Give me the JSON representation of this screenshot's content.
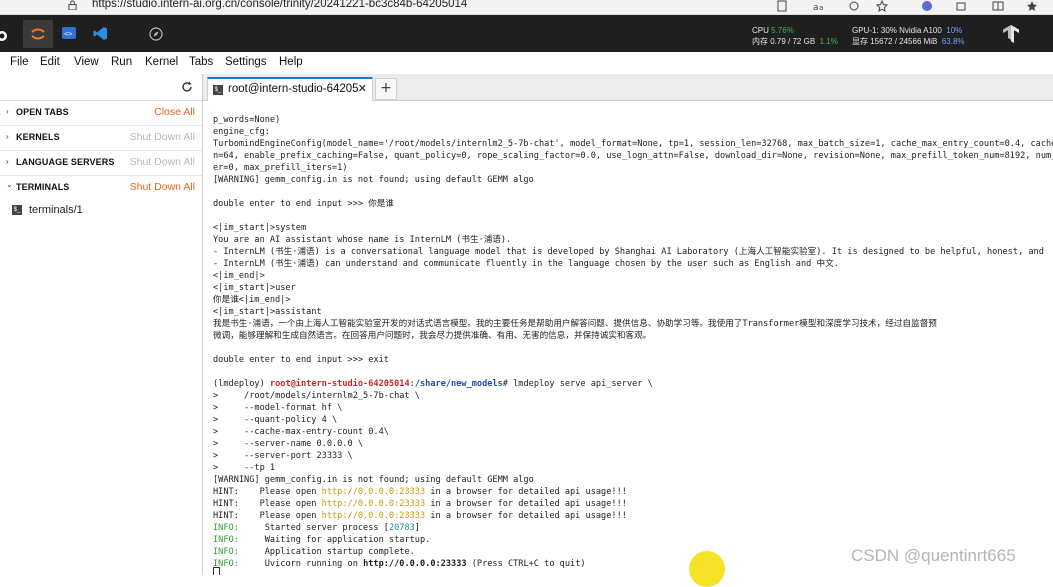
{
  "browser": {
    "url": "https://studio.intern-ai.org.cn/console/trinity/20241221-bc3c84b-64205014"
  },
  "stats": {
    "cpu_label": "CPU",
    "cpu_value": "5.76%",
    "mem_label": "内存",
    "mem_value": "0.79 / 72 GB",
    "mem_pct": "1.1%",
    "gpu_label": "GPU-1: 30% Nvidia A100",
    "gpu_pct": "10%",
    "vram_label": "显存",
    "vram_value": "15672 / 24566 MiB",
    "vram_pct": "63.8%"
  },
  "menu": [
    "File",
    "Edit",
    "View",
    "Run",
    "Kernel",
    "Tabs",
    "Settings",
    "Help"
  ],
  "sidebar": {
    "sections": [
      {
        "title": "OPEN TABS",
        "action": "Close All",
        "chevron": "›",
        "active": true
      },
      {
        "title": "KERNELS",
        "action": "Shut Down All",
        "chevron": "›",
        "active": false
      },
      {
        "title": "LANGUAGE SERVERS",
        "action": "Shut Down All",
        "chevron": "›",
        "active": false
      },
      {
        "title": "TERMINALS",
        "action": "Shut Down All",
        "chevron": "⌄",
        "active": true
      }
    ],
    "terminal_item": "terminals/1"
  },
  "tab": {
    "label": "root@intern-studio-64205",
    "close": "✕",
    "add": "+"
  },
  "terminal": {
    "l1": "p_words=None)",
    "l2": "engine_cfg:",
    "l3": "TurbomindEngineConfig(model_name='/root/models/internlm2_5-7b-chat', model_format=None, tp=1, session_len=32768, max_batch_size=1, cache_max_entry_count=0.4, cache_bl",
    "l4": "n=64, enable_prefix_caching=False, quant_policy=0, rope_scaling_factor=0.0, use_logn_attn=False, download_dir=None, revision=None, max_prefill_token_num=8192, num_tok",
    "l5": "er=0, max_prefill_iters=1)",
    "l6": "[WARNING] gemm_config.in is not found; using default GEMM algo",
    "l7": "double enter to end input >>> 你是谁",
    "l8": "<|im_start|>system",
    "l9": "You are an AI assistant whose name is InternLM (书生·浦语).",
    "l10": "- InternLM (书生·浦语) is a conversational language model that is developed by Shanghai AI Laboratory (上海人工智能实验室). It is designed to be helpful, honest, and",
    "l11": "- InternLM (书生·浦语) can understand and communicate fluently in the language chosen by the user such as English and 中文.",
    "l12": "<|im_end|>",
    "l13": "<|im_start|>user",
    "l14": "你是谁<|im_end|>",
    "l15": "<|im_start|>assistant",
    "l16": "我是书生·浦语，一个由上海人工智能实验室开发的对话式语言模型。我的主要任务是帮助用户解答问题、提供信息、协助学习等。我使用了Transformer模型和深度学习技术，经过自监督预",
    "l17": "微调，能够理解和生成自然语言。在回答用户问题时，我会尽力提供准确、有用、无害的信息，并保持诚实和客观。",
    "l18": "double enter to end input >>> exit",
    "p_env": "(lmdeploy) ",
    "p_user": "root@intern-studio-64205014",
    "p_colon": ":",
    "p_path": "/share/new_models",
    "p_cmd": "# lmdeploy serve api_server \\",
    "c1": ">     /root/models/internlm2_5-7b-chat \\",
    "c2": ">     --model-format hf \\",
    "c3": ">     --quant-policy 4 \\",
    "c4": ">     --cache-max-entry-count 0.4\\",
    "c5": ">     --server-name 0.0.0.0 \\",
    "c6": ">     --server-port 23333 \\",
    "c7": ">     --tp 1",
    "w2": "[WARNING] gemm_config.in is not found; using default GEMM algo",
    "hint_prefix": "HINT:    Please open ",
    "hint_url": "http://0.0.0.0:23333",
    "hint_suffix": " in a browser for detailed api usage!!!",
    "info_label": "INFO:",
    "i1a": "     Started server process [",
    "i1pid": "20783",
    "i1b": "]",
    "i2": "     Waiting for application startup.",
    "i3": "     Application startup complete.",
    "i4a": "     Uvicorn running on ",
    "i4url": "http://0.0.0.0:23333",
    "i4b": " (Press CTRL+C to quit)"
  },
  "watermark": "CSDN @quentinrt665",
  "colors": {
    "accent_orange": "#e8651a",
    "tab_blue": "#1976d2",
    "terminal_green": "#3a9a3a",
    "terminal_red": "#c62828"
  }
}
